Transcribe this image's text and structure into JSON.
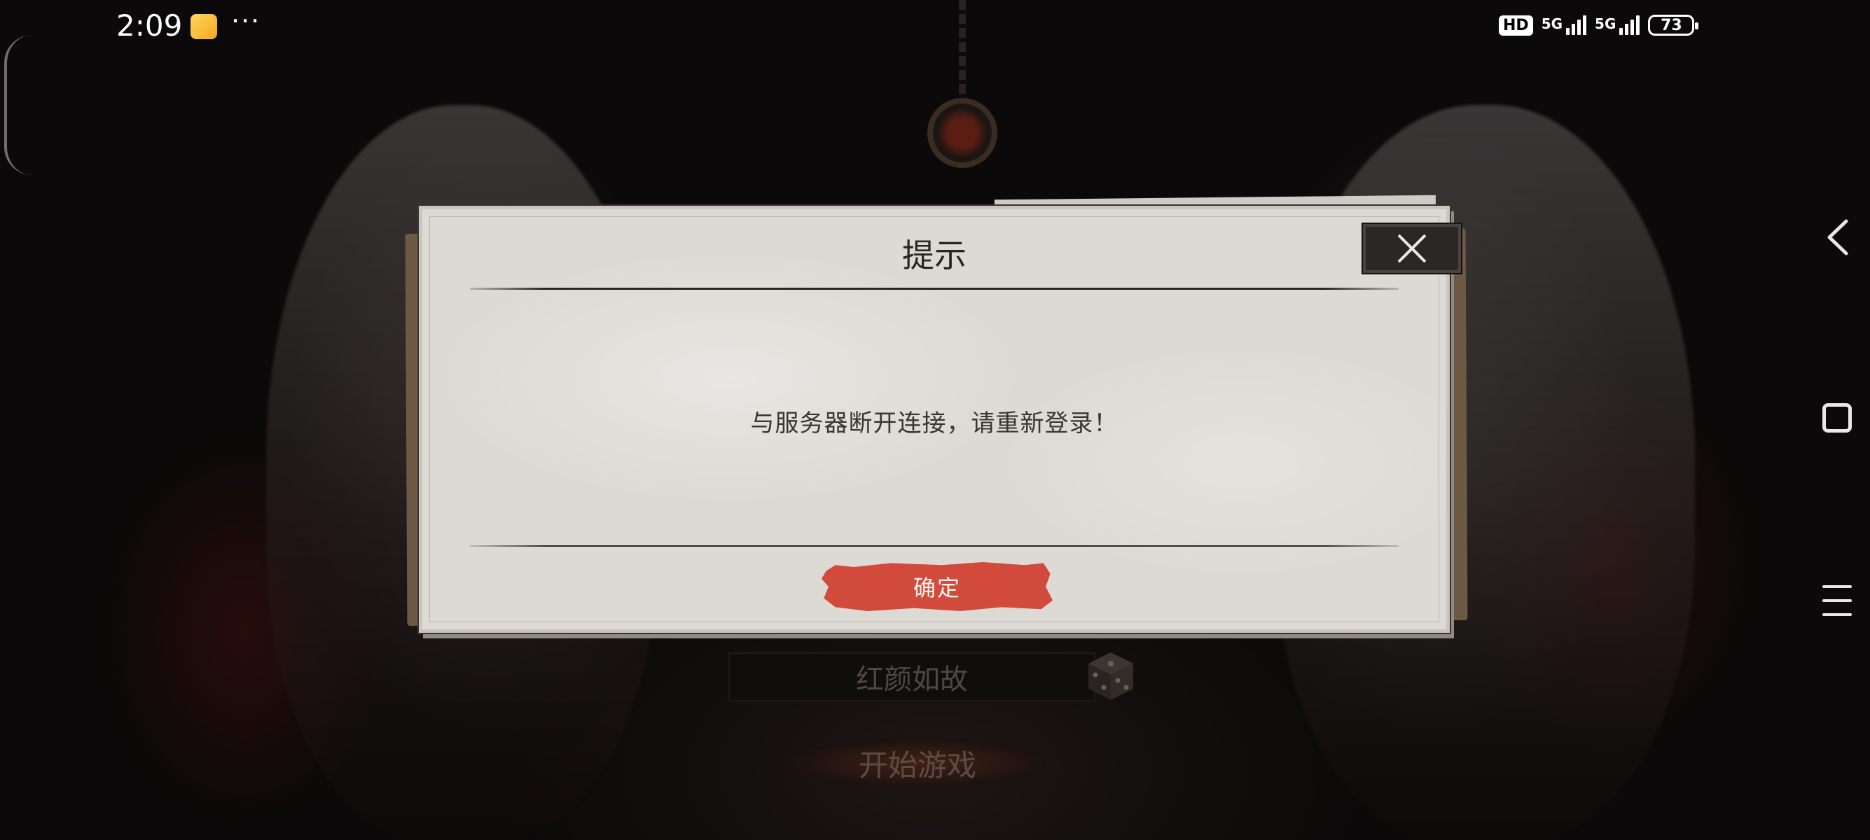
{
  "status_bar": {
    "time": "2:09",
    "more": "···",
    "hd_badge": "HD",
    "network_1": "5G",
    "network_2": "5G",
    "battery": "73"
  },
  "dialog": {
    "title": "提示",
    "message": "与服务器断开连接，请重新登录！",
    "confirm_label": "确定"
  },
  "game": {
    "server_name": "红颜如故",
    "start_label": "开始游戏"
  },
  "icons": {
    "close": "close-icon",
    "dice": "dice-icon",
    "back": "back-icon",
    "home": "home-icon",
    "menu": "menu-icon"
  },
  "colors": {
    "confirm_button": "#d24a3c",
    "dialog_paper": "#ddd9d4",
    "close_button": "#2b2725"
  }
}
